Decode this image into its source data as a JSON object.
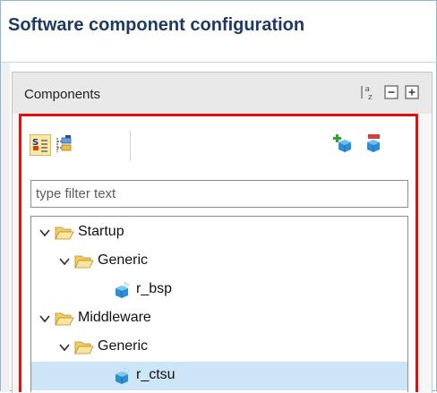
{
  "window": {
    "title": "Software component configuration"
  },
  "components_panel": {
    "title": "Components",
    "header_icons": [
      "sort-alphabetical-icon",
      "collapse-all-icon",
      "expand-all-icon"
    ],
    "toolbar_icons": [
      "show-components-icon",
      "show-hierarchy-icon",
      "add-component-icon",
      "remove-component-icon"
    ],
    "filter": {
      "value": "",
      "placeholder": "type filter text"
    },
    "tree": [
      {
        "label": "Startup",
        "type": "folder",
        "level": 0,
        "expanded": true
      },
      {
        "label": "Generic",
        "type": "folder",
        "level": 1,
        "expanded": true
      },
      {
        "label": "r_bsp",
        "type": "component",
        "level": 2
      },
      {
        "label": "Middleware",
        "type": "folder",
        "level": 0,
        "expanded": true
      },
      {
        "label": "Generic",
        "type": "folder",
        "level": 1,
        "expanded": true
      },
      {
        "label": "r_ctsu",
        "type": "component",
        "level": 2,
        "selected": true
      }
    ]
  },
  "colors": {
    "highlight_border": "#e10f0f",
    "selection": "#cce5f7",
    "title_text": "#1e3a62",
    "frame_border": "#8fb5d9"
  }
}
